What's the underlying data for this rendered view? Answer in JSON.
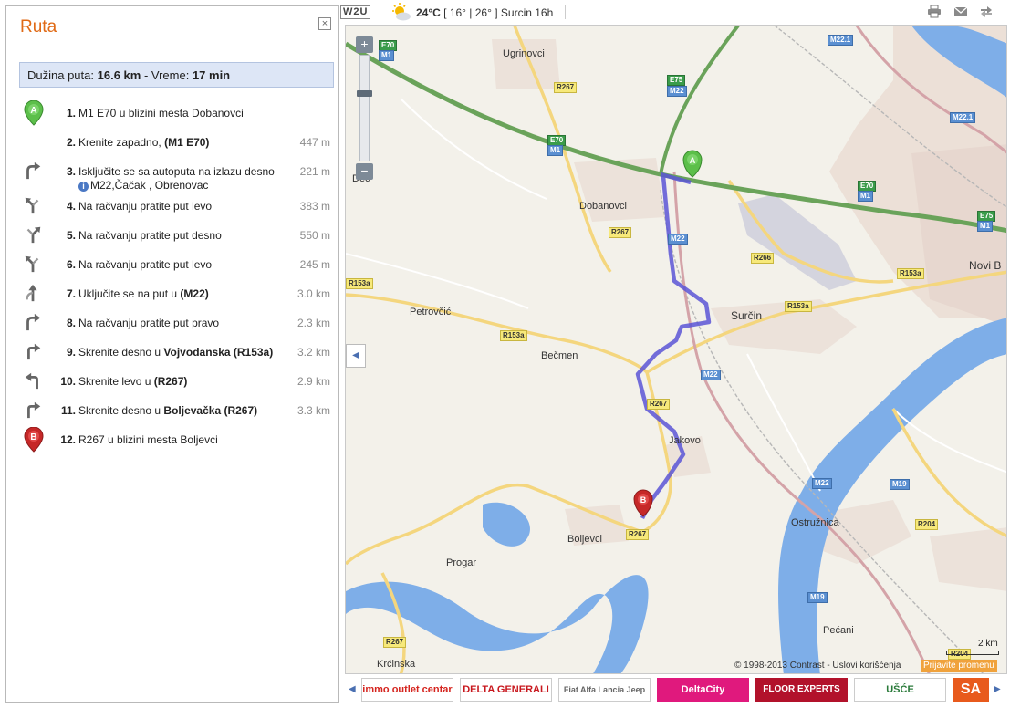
{
  "panel": {
    "title": "Ruta",
    "close": "×",
    "summary": {
      "length_label": "Dužina puta:",
      "length": "16.6 km",
      "sep": "- Vreme:",
      "time": "17 min"
    },
    "steps": [
      {
        "num": "1.",
        "icon": "marker-a-icon",
        "text_pre": "M1 E70 u blizini mesta Dobanovci",
        "text_bold": "",
        "dist": ""
      },
      {
        "num": "2.",
        "icon": "none",
        "text_pre": "Krenite zapadno, ",
        "text_bold": "(M1 E70)",
        "dist": "447 m"
      },
      {
        "num": "3.",
        "icon": "turn-slight-right-icon",
        "text_pre": "Isključite se sa autoputa na izlazu desno",
        "text_bold": "",
        "sub": "M22,Čačak , Obrenovac",
        "dist": "221 m"
      },
      {
        "num": "4.",
        "icon": "fork-left-icon",
        "text_pre": "Na račvanju pratite put levo",
        "text_bold": "",
        "dist": "383 m"
      },
      {
        "num": "5.",
        "icon": "fork-right-icon",
        "text_pre": "Na račvanju pratite put desno",
        "text_bold": "",
        "dist": "550 m"
      },
      {
        "num": "6.",
        "icon": "fork-left-icon",
        "text_pre": "Na račvanju pratite put levo",
        "text_bold": "",
        "dist": "245 m"
      },
      {
        "num": "7.",
        "icon": "merge-icon",
        "text_pre": "Uključite se na put u ",
        "text_bold": "(M22)",
        "dist": "3.0 km"
      },
      {
        "num": "8.",
        "icon": "turn-slight-right-icon",
        "text_pre": "Na račvanju pratite put pravo",
        "text_bold": "",
        "dist": "2.3 km"
      },
      {
        "num": "9.",
        "icon": "turn-right-icon",
        "text_pre": "Skrenite desno u ",
        "text_bold": "Vojvođanska (R153a)",
        "dist": "3.2 km"
      },
      {
        "num": "10.",
        "icon": "turn-left-icon",
        "text_pre": "Skrenite levo u ",
        "text_bold": "(R267)",
        "dist": "2.9 km"
      },
      {
        "num": "11.",
        "icon": "turn-right-icon",
        "text_pre": "Skrenite desno u ",
        "text_bold": "Boljevačka (R267)",
        "dist": "3.3 km"
      },
      {
        "num": "12.",
        "icon": "marker-b-icon",
        "text_pre": "R267 u blizini mesta Boljevci",
        "text_bold": "",
        "dist": ""
      }
    ]
  },
  "toolbar": {
    "w2u": "W2U",
    "temp_main": "24°C",
    "temp_detail": "[ 16° | 26° ] Surcin 16h"
  },
  "map": {
    "zoom_in": "+",
    "zoom_out": "−",
    "collapse": "◀",
    "markers": {
      "a": "A",
      "b": "B"
    },
    "places": [
      "Ugrinovci",
      "Dobanovci",
      "Petrovčić",
      "Bečmen",
      "Surčin",
      "Jakovo",
      "Boljevci",
      "Progar",
      "Ostružnica",
      "Pećani",
      "Novi B",
      "Krćinska",
      "Deč"
    ],
    "road_labels": [
      "E70",
      "M1",
      "R267",
      "E75",
      "M22",
      "M22.1",
      "M22.1",
      "R266",
      "R153a",
      "R153a",
      "R153a",
      "R153a",
      "R267",
      "M22",
      "R267",
      "R267",
      "M22",
      "M19",
      "R204",
      "M22",
      "M19",
      "R267",
      "R204",
      "E70",
      "M1",
      "E75",
      "M1"
    ],
    "scale": "2 km",
    "copyright": "© 1998-2013 Contrast -  Uslovi korišćenja",
    "report": "Prijavite promenu"
  },
  "ads": [
    {
      "label": "immo outlet centar",
      "color": "#d5241e"
    },
    {
      "label": "DELTA GENERALI",
      "color": "#c8181e"
    },
    {
      "label": "Fiat Alfa Lancia Jeep",
      "color": "#666666"
    },
    {
      "label": "DeltaCity",
      "color": "#e0197d"
    },
    {
      "label": "FLOOR EXPERTS",
      "color": "#b2122b"
    },
    {
      "label": "UŠĆE",
      "color": "#2a7a3a"
    },
    {
      "label": "SA",
      "color": "#e85a1c"
    }
  ],
  "colors": {
    "accent": "#e06a16",
    "route": "#5a55d6",
    "motorway": "#6aa35a",
    "water": "#7eaee8"
  }
}
